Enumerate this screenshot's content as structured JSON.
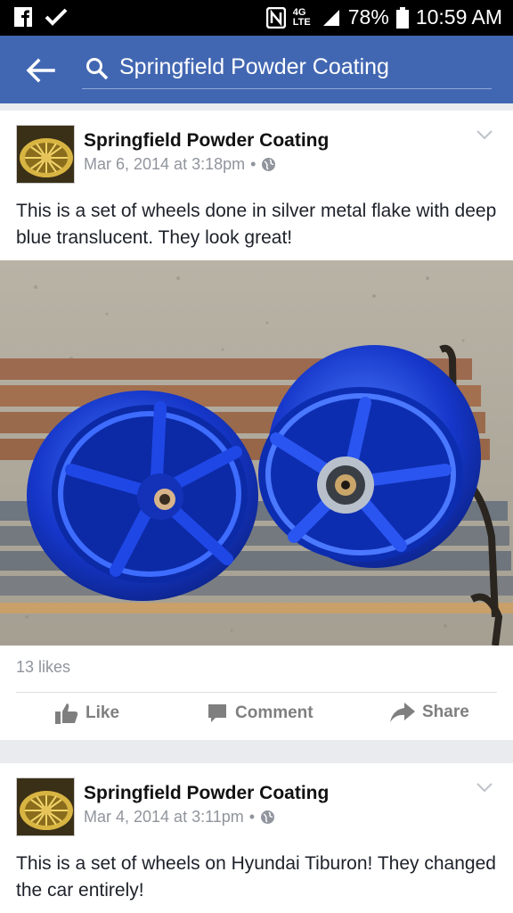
{
  "status_bar": {
    "battery_percent": "78%",
    "time": "10:59 AM",
    "network": "4G LTE",
    "icons": [
      "facebook-icon",
      "check-icon",
      "nfc-icon",
      "signal-icon",
      "battery-icon"
    ]
  },
  "header": {
    "search_text": "Springfield Powder Coating",
    "color": "#4267b2"
  },
  "posts": [
    {
      "page_name": "Springfield Powder Coating",
      "date": "Mar 6, 2014 at 3:18pm",
      "separator": "•",
      "text": "This is a set of wheels done in silver metal flake with deep blue translucent. They look great!",
      "likes": "13 likes",
      "actions": {
        "like": "Like",
        "comment": "Comment",
        "share": "Share"
      }
    },
    {
      "page_name": "Springfield Powder Coating",
      "date": "Mar 4, 2014 at 3:11pm",
      "separator": "•",
      "text": "This is a set of wheels on Hyundai Tiburon! They changed the car entirely!"
    }
  ]
}
